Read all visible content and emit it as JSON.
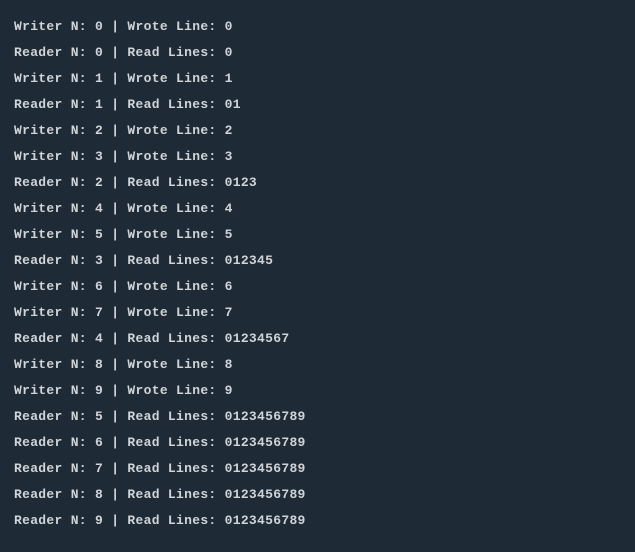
{
  "lines": [
    "Writer N: 0 | Wrote Line: 0",
    "Reader N: 0 | Read Lines: 0",
    "Writer N: 1 | Wrote Line: 1",
    "Reader N: 1 | Read Lines: 01",
    "Writer N: 2 | Wrote Line: 2",
    "Writer N: 3 | Wrote Line: 3",
    "Reader N: 2 | Read Lines: 0123",
    "Writer N: 4 | Wrote Line: 4",
    "Writer N: 5 | Wrote Line: 5",
    "Reader N: 3 | Read Lines: 012345",
    "Writer N: 6 | Wrote Line: 6",
    "Writer N: 7 | Wrote Line: 7",
    "Reader N: 4 | Read Lines: 01234567",
    "Writer N: 8 | Wrote Line: 8",
    "Writer N: 9 | Wrote Line: 9",
    "Reader N: 5 | Read Lines: 0123456789",
    "Reader N: 6 | Read Lines: 0123456789",
    "Reader N: 7 | Read Lines: 0123456789",
    "Reader N: 8 | Read Lines: 0123456789",
    "Reader N: 9 | Read Lines: 0123456789"
  ]
}
